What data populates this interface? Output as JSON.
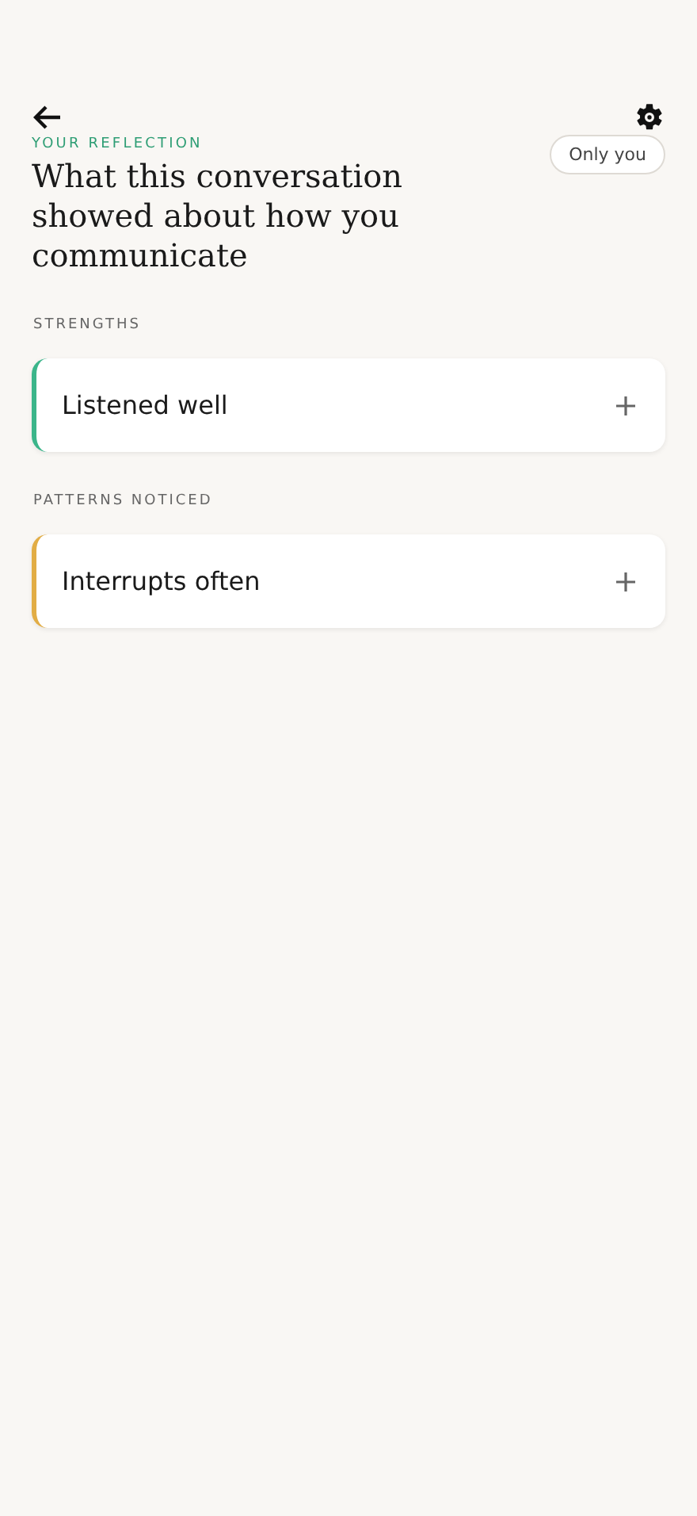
{
  "header": {
    "eyebrow": "YOUR REFLECTION",
    "title": "What this conversation showed about how you communicate",
    "visibility": "Only you"
  },
  "sections": [
    {
      "label": "STRENGTHS",
      "items": [
        {
          "text": "Listened well",
          "color": "#3bb58a",
          "expanded": false
        }
      ]
    },
    {
      "label": "PATTERNS NOTICED",
      "items": [
        {
          "text": "Interrupts often",
          "color": "#e2ad45",
          "expanded": false
        }
      ]
    }
  ]
}
